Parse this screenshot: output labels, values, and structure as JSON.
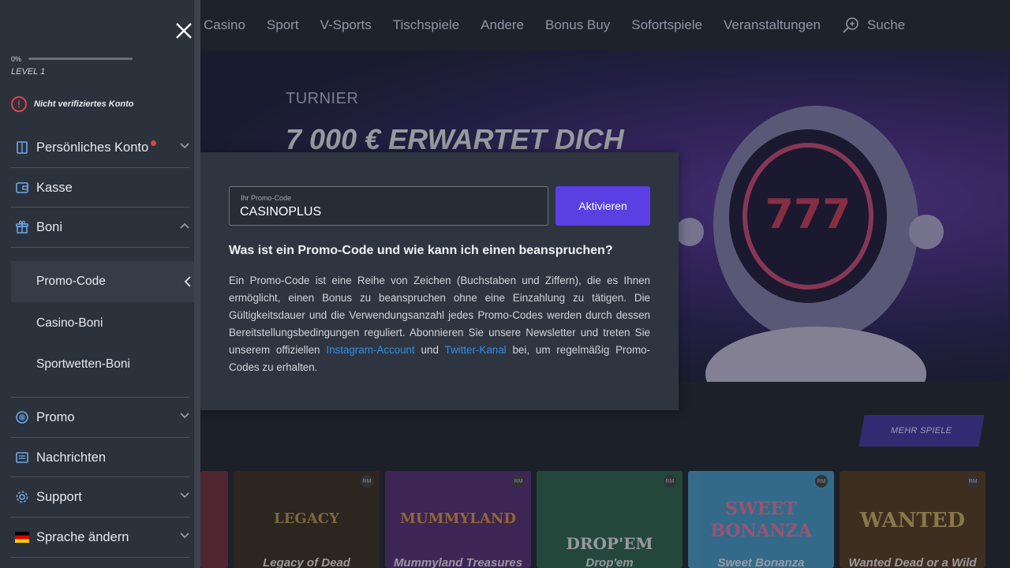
{
  "topnav": {
    "items": [
      "Casino",
      "Sport",
      "V-Sports",
      "Tischspiele",
      "Andere",
      "Bonus Buy",
      "Sofortspiele",
      "Veranstaltungen"
    ],
    "search_label": "Suche"
  },
  "hero": {
    "label": "TURNIER",
    "title": "7 000 € ERWARTET DICH"
  },
  "games": {
    "more_label": "MEHR SPIELE",
    "badge": "RM",
    "tiles": [
      {
        "name": "Legacy of Dead",
        "art": "LEGACY",
        "color": "#c9a34a",
        "bg": "#3a2a1a"
      },
      {
        "name": "Mummyland Treasures",
        "art": "MUMMYLAND",
        "color": "#f2a23a",
        "bg": "#5a2a7a"
      },
      {
        "name": "Drop'em",
        "art": "DROP'EM",
        "color": "#ffffff",
        "bg": "#2a6a4a"
      },
      {
        "name": "Sweet Bonanza",
        "art": "SWEET BONANZA",
        "color": "#ff7fb0",
        "bg": "#4aa8d8"
      },
      {
        "name": "Wanted Dead or a Wild",
        "art": "WANTED",
        "color": "#e0c060",
        "bg": "#5a3a1a"
      }
    ]
  },
  "popup": {
    "field_label": "Ihr Promo-Code",
    "field_value": "CASINOPLUS",
    "activate_label": "Aktivieren",
    "heading": "Was ist ein Promo-Code und wie kann ich einen beanspruchen?",
    "body_1": "Ein Promo-Code ist eine Reihe von Zeichen (Buchstaben und Ziffern), die es Ihnen ermöglicht, einen Bonus zu beanspruchen ohne eine Einzahlung zu tätigen. Die Gültigkeitsdauer und die Verwendungsanzahl jedes Promo-Codes werden durch dessen Bereitstellungsbedingungen reguliert. Abonnieren Sie unsere Newsletter und treten Sie unserem offiziellen ",
    "link_1": "Instagram-Account",
    "body_2": " und ",
    "link_2": "Twitter-Kanal",
    "body_3": " bei, um regelmäßig Promo-Codes zu erhalten."
  },
  "sidebar": {
    "progress_pct": "0%",
    "progress_fraction": 0,
    "level": "LEVEL 1",
    "verify_text": "Nicht verifiziertes Konto",
    "items": {
      "account": "Persönliches Konto",
      "cashier": "Kasse",
      "bonuses": "Boni",
      "promo": "Promo",
      "news": "Nachrichten",
      "support": "Support",
      "language": "Sprache ändern"
    },
    "sub_items": {
      "promo_code": "Promo-Code",
      "casino_bonuses": "Casino-Boni",
      "sport_bonuses": "Sportwetten-Boni"
    }
  },
  "colors": {
    "accent": "#5a3fe2",
    "alert": "#e0424a",
    "link": "#2f8fe6"
  }
}
